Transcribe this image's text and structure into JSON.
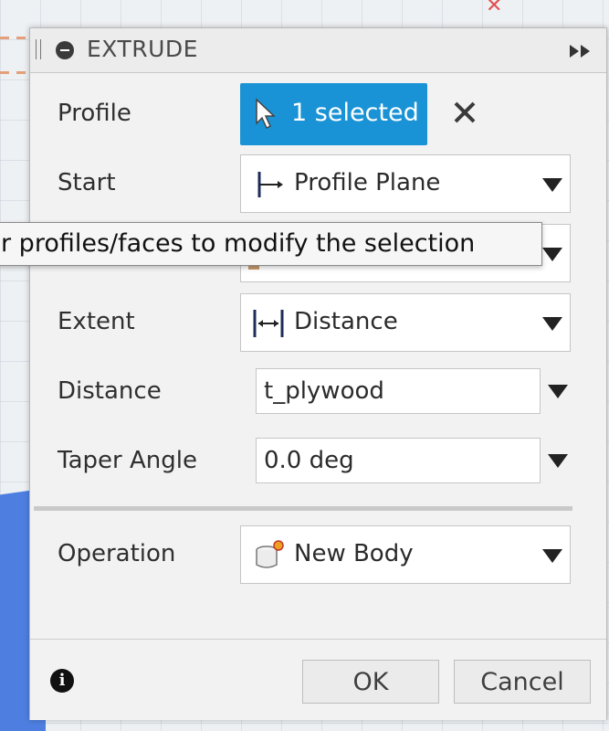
{
  "panel": {
    "title": "EXTRUDE"
  },
  "profile": {
    "label": "Profile",
    "selection_label": "1 selected"
  },
  "start": {
    "label": "Start",
    "value": "Profile Plane"
  },
  "tooltip": {
    "text": "r profiles/faces to modify the selection"
  },
  "extent": {
    "label": "Extent",
    "value": "Distance"
  },
  "distance": {
    "label": "Distance",
    "value": "t_plywood"
  },
  "taper_angle": {
    "label": "Taper Angle",
    "value": "0.0 deg"
  },
  "operation": {
    "label": "Operation",
    "value": "New Body"
  },
  "footer": {
    "ok_label": "OK",
    "cancel_label": "Cancel"
  },
  "colors": {
    "accent": "#1a93d6",
    "panel_bg": "#f2f2f2"
  }
}
